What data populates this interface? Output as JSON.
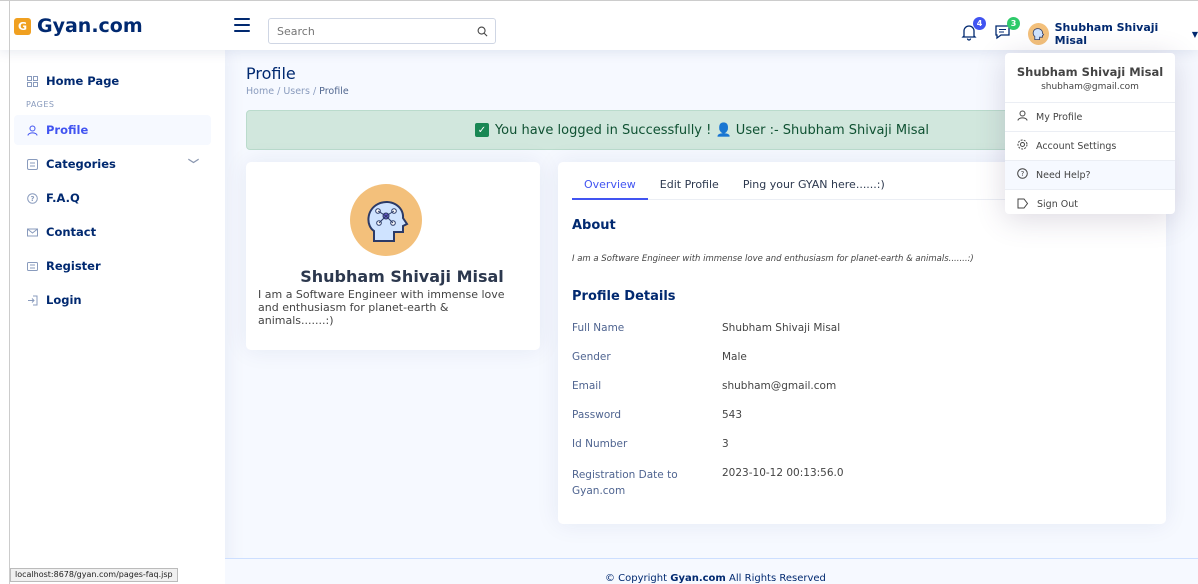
{
  "header": {
    "logo_mark": "G",
    "logo_text": "Gyan.com",
    "search_placeholder": "Search",
    "notifications_count": "4",
    "messages_count": "3",
    "user_name": "Shubham Shivaji Misal"
  },
  "sidebar": {
    "home": "Home Page",
    "heading": "PAGES",
    "items": [
      "Profile",
      "Categories",
      "F.A.Q",
      "Contact",
      "Register",
      "Login"
    ]
  },
  "page": {
    "title": "Profile",
    "breadcrumb": [
      "Home",
      "Users",
      "Profile"
    ],
    "alert": "You have logged in Successfully ! 👤 User :- Shubham Shivaji Misal"
  },
  "profile_card": {
    "name": "Shubham Shivaji Misal",
    "bio": "I am a Software Engineer with immense love and enthusiasm for planet-earth & animals.......:)"
  },
  "details": {
    "tabs": [
      "Overview",
      "Edit Profile",
      "Ping your GYAN here......:)"
    ],
    "about_title": "About",
    "about_text": "I am a Software Engineer with immense love and enthusiasm for planet-earth & animals.......:)",
    "section_title": "Profile Details",
    "rows": [
      {
        "label": "Full Name",
        "value": "Shubham Shivaji Misal"
      },
      {
        "label": "Gender",
        "value": "Male"
      },
      {
        "label": "Email",
        "value": "shubham@gmail.com"
      },
      {
        "label": "Password",
        "value": "543"
      },
      {
        "label": "Id Number",
        "value": "3"
      },
      {
        "label": "Registration Date to Gyan.com",
        "value": "2023-10-12 00:13:56.0"
      }
    ]
  },
  "dropdown": {
    "name": "Shubham Shivaji Misal",
    "email": "shubham@gmail.com",
    "items": [
      "My Profile",
      "Account Settings",
      "Need Help?",
      "Sign Out"
    ]
  },
  "footer": {
    "prefix": "© Copyright ",
    "brand": "Gyan.com",
    "suffix": " All Rights Reserved"
  },
  "status_url": "localhost:8678/gyan.com/pages-faq.jsp",
  "colors": {
    "primary": "#4154f1",
    "navy": "#012970",
    "success_bg": "#d1e7dd",
    "avatar_bg": "#f3c07b"
  }
}
